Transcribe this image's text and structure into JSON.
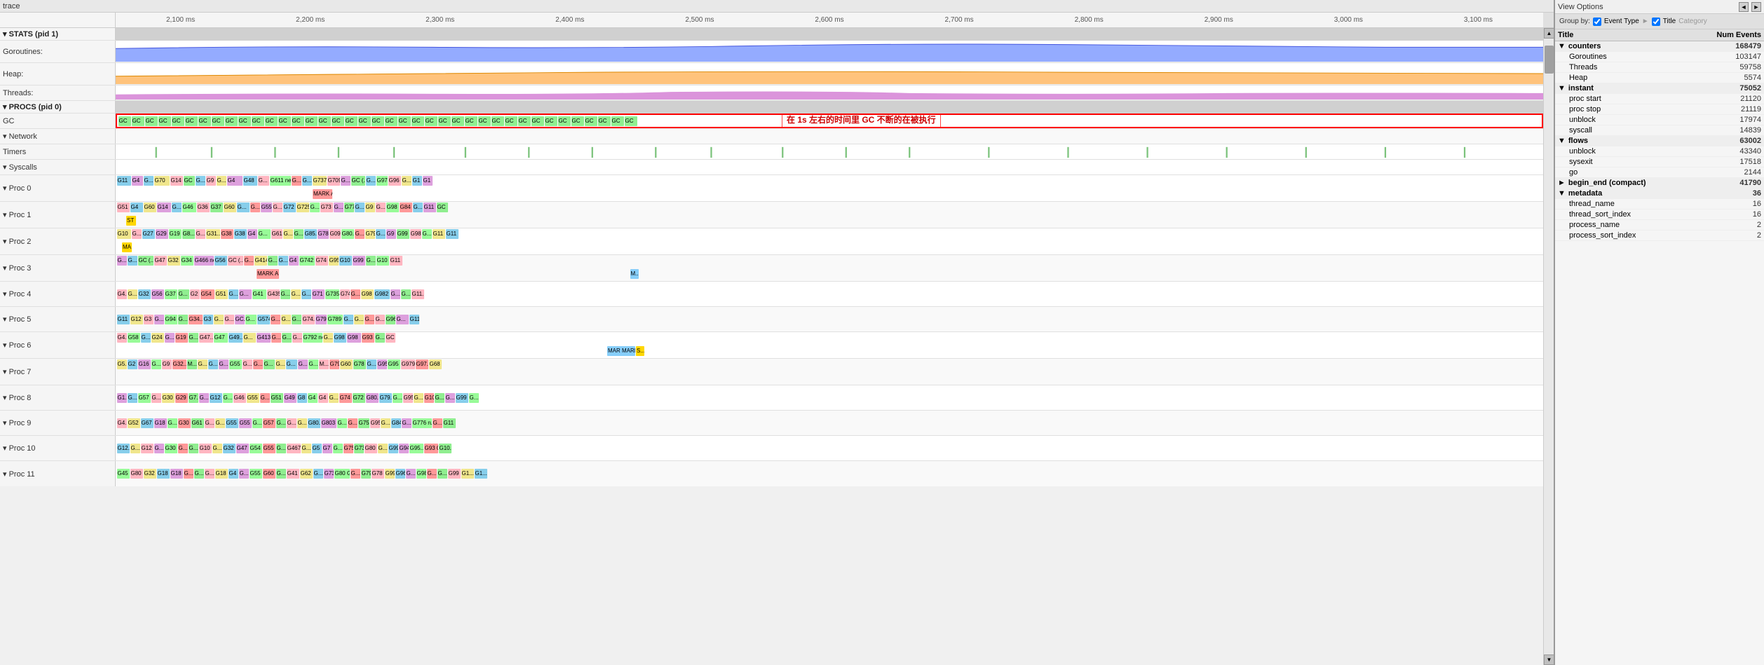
{
  "titleBar": {
    "label": "trace"
  },
  "viewOptions": {
    "label": "View Options"
  },
  "toolbar": {
    "groupBy": "Group by:",
    "eventTypeLabel": "Event Type",
    "titleLabel": "Title",
    "categoryLabel": "Category"
  },
  "timeline": {
    "ticks": [
      "2,100 ms",
      "2,200 ms",
      "2,300 ms",
      "2,400 ms",
      "2,500 ms",
      "2,600 ms",
      "2,700 ms",
      "2,800 ms",
      "2,900 ms",
      "3,000 ms",
      "3,100 ms"
    ]
  },
  "rows": {
    "stats": "▾ STATS (pid 1)",
    "goroutines": "Goroutines:",
    "heap": "Heap:",
    "threads": "Threads:",
    "procs": "▾ PROCS (pid 0)",
    "gc": "GC",
    "network": "▾ Network",
    "timers": "Timers",
    "syscalls": "▾ Syscalls",
    "proc0": "▾ Proc 0",
    "proc1": "▾ Proc 1",
    "proc2": "▾ Proc 2",
    "proc3": "▾ Proc 3",
    "proc4": "▾ Proc 4",
    "proc5": "▾ Proc 5",
    "proc6": "▾ Proc 6",
    "proc7": "▾ Proc 7",
    "proc8": "▾ Proc 8",
    "proc9": "▾ Proc 9",
    "proc10": "▾ Proc 10",
    "proc11": "▾ Proc 11"
  },
  "annotation": "在 1s 左右的时间里 GC 不断的在被执行",
  "metrics": {
    "titleCol": "Title",
    "eventsCol": "Num Events",
    "groups": [
      {
        "name": "counters",
        "count": "168479",
        "expanded": true,
        "children": [
          {
            "name": "Goroutines",
            "count": "103147"
          },
          {
            "name": "Threads",
            "count": "59758"
          },
          {
            "name": "Heap",
            "count": "5574"
          }
        ]
      },
      {
        "name": "instant",
        "count": "75052",
        "expanded": true,
        "children": [
          {
            "name": "proc start",
            "count": "21120"
          },
          {
            "name": "proc stop",
            "count": "21119"
          },
          {
            "name": "unblock",
            "count": "17974"
          },
          {
            "name": "syscall",
            "count": "14839"
          }
        ]
      },
      {
        "name": "flows",
        "count": "63002",
        "expanded": true,
        "children": [
          {
            "name": "unblock",
            "count": "43340"
          },
          {
            "name": "sysexit",
            "count": "17518"
          },
          {
            "name": "go",
            "count": "2144"
          }
        ]
      },
      {
        "name": "begin_end (compact)",
        "count": "41790",
        "expanded": false,
        "children": []
      },
      {
        "name": "metadata",
        "count": "36",
        "expanded": true,
        "children": [
          {
            "name": "thread_name",
            "count": "16"
          },
          {
            "name": "thread_sort_index",
            "count": "16"
          },
          {
            "name": "process_name",
            "count": "2"
          },
          {
            "name": "process_sort_index",
            "count": "2"
          }
        ]
      }
    ]
  }
}
